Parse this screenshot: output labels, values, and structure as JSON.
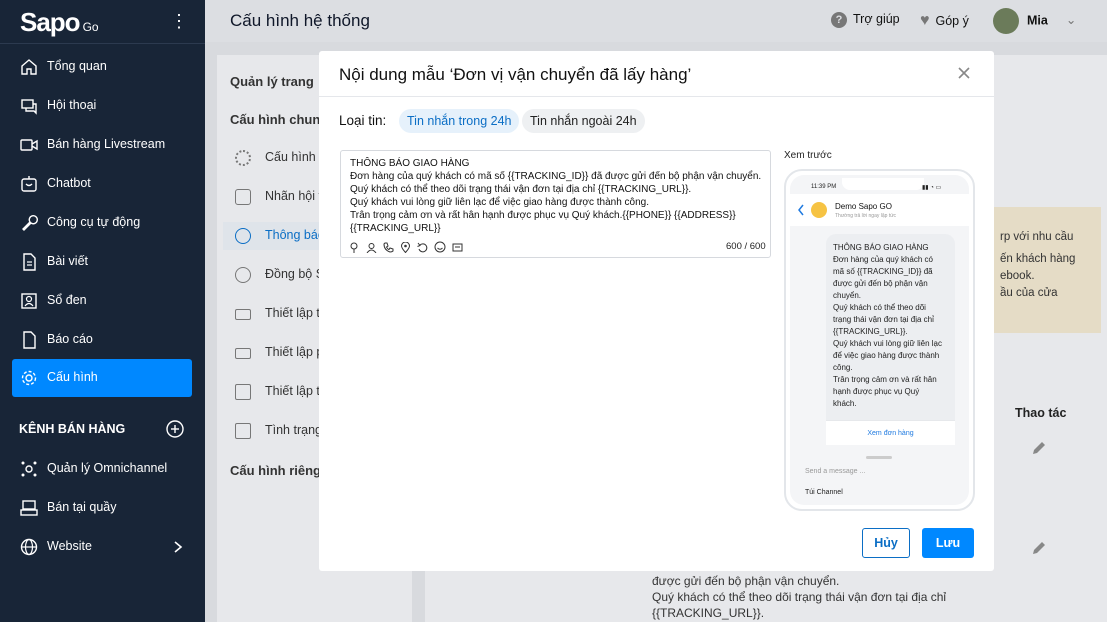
{
  "app": {
    "logo": "Sapo",
    "logo_suffix": "Go"
  },
  "sidebar": {
    "items": [
      {
        "label": "Tổng quan",
        "icon": "home-icon"
      },
      {
        "label": "Hội thoại",
        "icon": "chat-icon"
      },
      {
        "label": "Bán hàng Livestream",
        "icon": "video-icon"
      },
      {
        "label": "Chatbot",
        "icon": "bot-icon"
      },
      {
        "label": "Công cụ tự động",
        "icon": "wrench-icon"
      },
      {
        "label": "Bài viết",
        "icon": "document-icon"
      },
      {
        "label": "Sổ đen",
        "icon": "blacklist-icon"
      },
      {
        "label": "Báo cáo",
        "icon": "report-icon"
      },
      {
        "label": "Cấu hình",
        "icon": "gear-icon",
        "active": true
      }
    ],
    "section_title": "KÊNH BÁN HÀNG",
    "channels": [
      {
        "label": "Quản lý Omnichannel",
        "icon": "omnichannel-icon"
      },
      {
        "label": "Bán tại quầy",
        "icon": "pos-icon"
      },
      {
        "label": "Website",
        "icon": "globe-icon"
      }
    ]
  },
  "topbar": {
    "title": "Cấu hình hệ thống",
    "help": "Trợ giúp",
    "feedback": "Góp ý",
    "user": "Mia"
  },
  "background": {
    "manage_page": "Quản lý trang",
    "general_config": "Cấu hình chung",
    "items": [
      "Cấu hình c",
      "Nhãn hội t",
      "Thông báo",
      "Đồng bộ S",
      "Thiết lập th",
      "Thiết lập p",
      "Thiết lập tr",
      "Tình trạng"
    ],
    "private_config": "Cấu hình riêng",
    "notice_lines": [
      "rp với nhu cầu",
      "ến khách hàng",
      "ebook.",
      "ầu của cửa"
    ],
    "column_action": "Thao tác",
    "text_lines": [
      "được gửi đến bộ phận vận chuyển.",
      "Quý khách có thể theo dõi trạng thái vận đơn tại địa chỉ",
      "{{TRACKING_URL}}."
    ]
  },
  "modal": {
    "title": "Nội dung mẫu ‘Đơn vị vận chuyển đã lấy hàng’",
    "type_label": "Loại tin:",
    "type_options": [
      "Tin nhắn trong 24h",
      "Tin nhắn ngoài 24h"
    ],
    "message_lines": [
      "THÔNG BÁO GIAO HÀNG",
      "Đơn hàng của quý khách có mã số {{TRACKING_ID}} đã được gửi đến bộ phận vận chuyển.",
      "Quý khách có thể theo dõi trạng thái vận đơn tại địa chỉ {{TRACKING_URL}}.",
      "Quý khách vui lòng giữ liên lạc để việc giao hàng được thành công.",
      "Trân trọng cảm ơn và rất hân hạnh được phục vụ Quý khách.{{PHONE}} {{ADDRESS}}",
      "{{TRACKING_URL}}"
    ],
    "counter": "600 / 600",
    "preview_label": "Xem trước",
    "preview": {
      "time": "11:39 PM",
      "name": "Demo Sapo GO",
      "subtitle": "Thường trả lời ngay lập tức",
      "bubble_lines": [
        "THÔNG BÁO GIAO HÀNG",
        "Đơn hàng của quý khách có",
        "mã số {{TRACKING_ID}} đã",
        "được gửi đến bộ phận vận",
        "chuyển.",
        "Quý khách có thể theo dõi",
        "trạng thái vận đơn tại địa chỉ",
        "{{TRACKING_URL}}.",
        "Quý khách vui lòng giữ liên lạc",
        "để việc giao hàng được thành",
        "công.",
        "Trân trọng cảm ơn và rất hân",
        "hạnh được phục vụ Quý",
        "khách."
      ],
      "button": "Xem đơn hàng",
      "input_placeholder": "Send a message ...",
      "channel": "Túi Channel"
    },
    "cancel": "Hủy",
    "save": "Lưu"
  }
}
